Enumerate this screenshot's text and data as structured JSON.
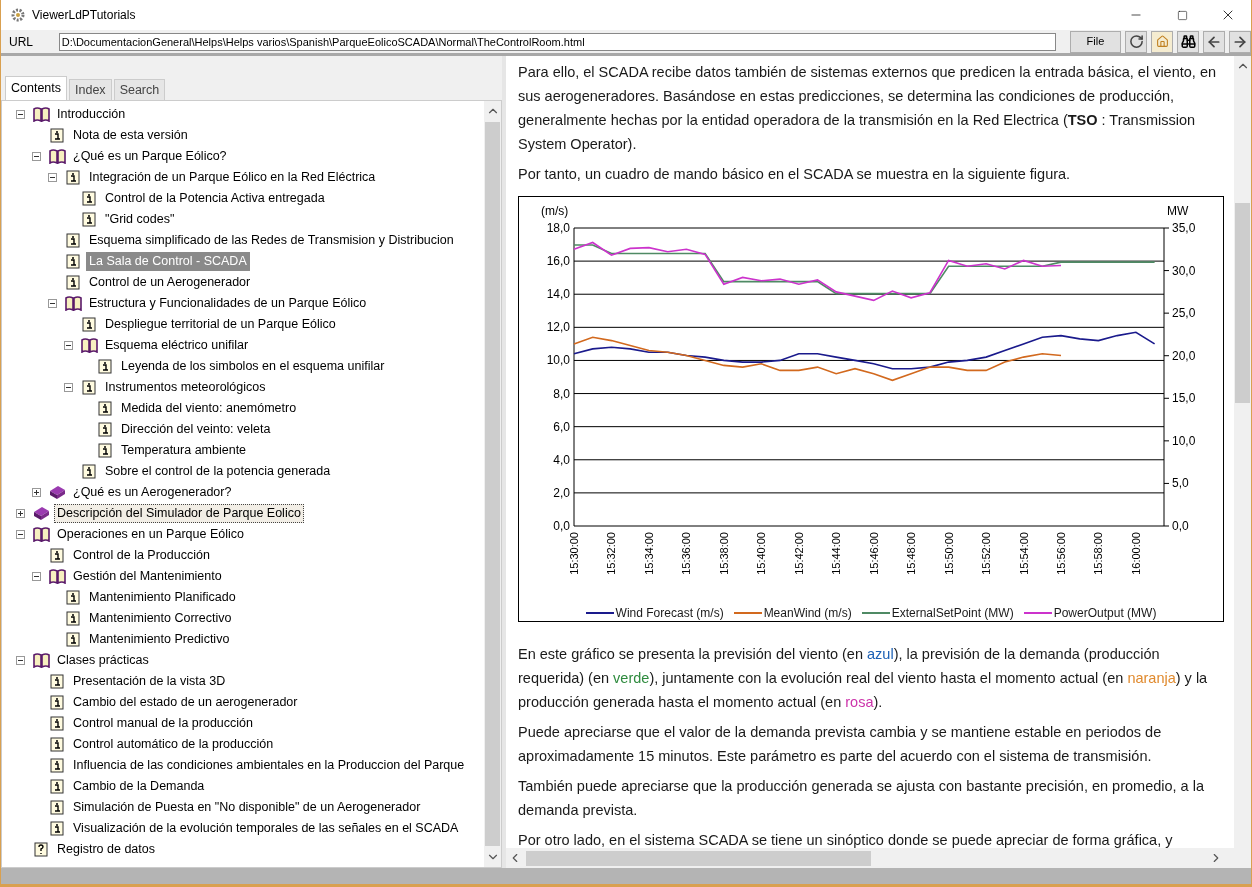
{
  "window": {
    "title": "ViewerLdPTutorials"
  },
  "url_bar": {
    "label": "URL",
    "value": "D:\\DocumentacionGeneral\\Helps\\Helps varios\\Spanish\\ParqueEolicoSCADA\\Normal\\TheControlRoom.html",
    "file_button": "File"
  },
  "tabs": [
    {
      "label": "Contents",
      "selected": true
    },
    {
      "label": "Index",
      "selected": false
    },
    {
      "label": "Search",
      "selected": false
    }
  ],
  "tree": [
    {
      "kind": "book",
      "label": "Introducción",
      "expanded": true,
      "selected": false,
      "focused": false,
      "children": [
        {
          "kind": "page",
          "label": "Nota de esta versión",
          "selected": false,
          "focused": false
        },
        {
          "kind": "book",
          "label": "¿Qué es un Parque Eólico?",
          "expanded": true,
          "selected": false,
          "focused": false,
          "children": [
            {
              "kind": "page",
              "label": "Integración de un Parque Eólico en la Red Eléctrica",
              "expanded": true,
              "selected": false,
              "focused": false,
              "children": [
                {
                  "kind": "page",
                  "label": "Control de la Potencia Activa entregada",
                  "selected": false,
                  "focused": false
                },
                {
                  "kind": "page",
                  "label": "\"Grid codes\"",
                  "selected": false,
                  "focused": false
                }
              ]
            },
            {
              "kind": "page",
              "label": "Esquema simplificado de las Redes de Transmision y Distribucion",
              "selected": false,
              "focused": false
            },
            {
              "kind": "page",
              "label": "La Sala de Control - SCADA",
              "selected": true,
              "focused": false
            },
            {
              "kind": "page",
              "label": "Control de un Aerogenerador",
              "selected": false,
              "focused": false
            },
            {
              "kind": "book",
              "label": "Estructura y Funcionalidades de un Parque Eólico",
              "expanded": true,
              "selected": false,
              "focused": false,
              "children": [
                {
                  "kind": "page",
                  "label": "Despliegue territorial de un Parque Eólico",
                  "selected": false,
                  "focused": false
                },
                {
                  "kind": "book",
                  "label": "Esquema eléctrico unifilar",
                  "expanded": true,
                  "selected": false,
                  "focused": false,
                  "children": [
                    {
                      "kind": "page",
                      "label": "Leyenda de los simbolos en el esquema unifilar",
                      "selected": false,
                      "focused": false
                    }
                  ]
                },
                {
                  "kind": "page",
                  "label": "Instrumentos meteorológicos",
                  "expanded": true,
                  "selected": false,
                  "focused": false,
                  "children": [
                    {
                      "kind": "page",
                      "label": "Medida del viento: anemómetro",
                      "selected": false,
                      "focused": false
                    },
                    {
                      "kind": "page",
                      "label": "Dirección del veinto: veleta",
                      "selected": false,
                      "focused": false
                    },
                    {
                      "kind": "page",
                      "label": "Temperatura ambiente",
                      "selected": false,
                      "focused": false
                    }
                  ]
                },
                {
                  "kind": "page",
                  "label": "Sobre el control de la potencia generada",
                  "selected": false,
                  "focused": false
                }
              ]
            }
          ]
        },
        {
          "kind": "book",
          "label": "¿Qué es un Aerogenerador?",
          "expanded": false,
          "selected": false,
          "focused": false
        }
      ]
    },
    {
      "kind": "book",
      "label": "Descripción del Simulador de Parque Eolico",
      "expanded": false,
      "selected": false,
      "focused": true
    },
    {
      "kind": "book",
      "label": "Operaciones en un Parque Eólico",
      "expanded": true,
      "selected": false,
      "focused": false,
      "children": [
        {
          "kind": "page",
          "label": "Control de la Producción",
          "selected": false,
          "focused": false
        },
        {
          "kind": "book",
          "label": "Gestión del Mantenimiento",
          "expanded": true,
          "selected": false,
          "focused": false,
          "children": [
            {
              "kind": "page",
              "label": "Mantenimiento Planificado",
              "selected": false,
              "focused": false
            },
            {
              "kind": "page",
              "label": "Mantenimiento Correctivo",
              "selected": false,
              "focused": false
            },
            {
              "kind": "page",
              "label": "Mantenimiento Predictivo",
              "selected": false,
              "focused": false
            }
          ]
        }
      ]
    },
    {
      "kind": "book",
      "label": "Clases prácticas",
      "expanded": true,
      "selected": false,
      "focused": false,
      "children": [
        {
          "kind": "page",
          "label": "Presentación de la vista 3D",
          "selected": false,
          "focused": false
        },
        {
          "kind": "page",
          "label": "Cambio del estado de un aerogenerador",
          "selected": false,
          "focused": false
        },
        {
          "kind": "page",
          "label": "Control manual de la producción",
          "selected": false,
          "focused": false
        },
        {
          "kind": "page",
          "label": "Control automático de la producción",
          "selected": false,
          "focused": false
        },
        {
          "kind": "page",
          "label": "Influencia de las condiciones ambientales en la Produccion del Parque",
          "selected": false,
          "focused": false
        },
        {
          "kind": "page",
          "label": "Cambio de la Demanda",
          "selected": false,
          "focused": false
        },
        {
          "kind": "page",
          "label": "Simulación de Puesta en \"No disponible\" de un Aerogenerador",
          "selected": false,
          "focused": false
        },
        {
          "kind": "page",
          "label": "Visualización de la evolución temporales de las señales en el SCADA",
          "selected": false,
          "focused": false
        }
      ]
    },
    {
      "kind": "help",
      "label": "Registro de datos",
      "selected": false,
      "focused": false
    }
  ],
  "content": {
    "intro": [
      "Para ello, el SCADA recibe datos también de sistemas externos que predicen la entrada básica, el viento, en sus aerogeneradores. Basándose en estas predicciones, se determina las condiciones de producción, generalmente hechas por la entidad operadora de la transmisión en la Red Electrica (**TSO** : Transmission System Operator).",
      "Por tanto, un cuadro de mando básico en el SCADA se muestra en la siguiente figura."
    ],
    "chart_data": {
      "type": "line",
      "grid": true,
      "legend": "bottom",
      "ylabel": "(m/s)",
      "y2label": "MW",
      "ylim": [
        0,
        18
      ],
      "yticks": [
        {
          "value": 0,
          "label": "0,0"
        },
        {
          "value": 2,
          "label": "2,0"
        },
        {
          "value": 4,
          "label": "4,0"
        },
        {
          "value": 6,
          "label": "6,0"
        },
        {
          "value": 8,
          "label": "8,0"
        },
        {
          "value": 10,
          "label": "10,0"
        },
        {
          "value": 12,
          "label": "12,0"
        },
        {
          "value": 14,
          "label": "14,0"
        },
        {
          "value": 16,
          "label": "16,0"
        },
        {
          "value": 18,
          "label": "18,0"
        }
      ],
      "y2lim": [
        0,
        35
      ],
      "y2ticks": [
        {
          "value": 0,
          "label": "0,0"
        },
        {
          "value": 5,
          "label": "5,0"
        },
        {
          "value": 10,
          "label": "10,0"
        },
        {
          "value": 15,
          "label": "15,0"
        },
        {
          "value": 20,
          "label": "20,0"
        },
        {
          "value": 25,
          "label": "25,0"
        },
        {
          "value": 30,
          "label": "30,0"
        },
        {
          "value": 35,
          "label": "35,0"
        }
      ],
      "categories": [
        "15:30:00",
        null,
        "15:32:00",
        null,
        "15:34:00",
        null,
        "15:36:00",
        null,
        "15:38:00",
        null,
        "15:40:00",
        null,
        "15:42:00",
        null,
        "15:44:00",
        null,
        "15:46:00",
        null,
        "15:48:00",
        null,
        "15:50:00",
        null,
        "15:52:00",
        null,
        "15:54:00",
        null,
        "15:56:00",
        null,
        "15:58:00",
        null,
        "16:00:00",
        null
      ],
      "series": [
        {
          "name": "Wind Forecast (m/s)",
          "color": "#1a1a8c",
          "values": [
            10.4,
            10.7,
            10.8,
            10.7,
            10.5,
            10.5,
            10.3,
            10.2,
            10.0,
            9.9,
            9.9,
            10.0,
            10.4,
            10.4,
            10.2,
            10.0,
            9.8,
            9.5,
            9.5,
            9.6,
            9.9,
            10.0,
            10.2,
            10.6,
            11.0,
            11.4,
            11.5,
            11.3,
            11.2,
            11.5,
            11.7,
            11.0
          ]
        },
        {
          "name": "MeanWind (m/s)",
          "color": "#d2691e",
          "values": [
            11.0,
            11.4,
            11.2,
            10.9,
            10.6,
            10.5,
            10.3,
            10.0,
            9.7,
            9.6,
            9.8,
            9.4,
            9.4,
            9.6,
            9.2,
            9.5,
            9.2,
            8.8,
            9.2,
            9.6,
            9.6,
            9.4,
            9.4,
            9.9,
            10.2,
            10.4,
            10.3,
            null,
            null,
            null,
            null,
            null
          ]
        },
        {
          "name": "ExternalSetPoint (MW)",
          "color": "#4f8a64",
          "axis": "y2",
          "values": [
            33,
            33,
            32,
            32,
            32,
            32,
            32,
            32,
            28.7,
            28.7,
            28.7,
            28.7,
            28.7,
            28.7,
            27.3,
            27.3,
            27.3,
            27.3,
            27.3,
            27.3,
            30.5,
            30.5,
            30.5,
            30.5,
            30.5,
            30.5,
            31,
            31,
            31,
            31,
            31,
            31
          ]
        },
        {
          "name": "PowerOutput (MW)",
          "color": "#cc33cc",
          "axis": "y2",
          "values": [
            32.5,
            33.3,
            31.8,
            32.6,
            32.7,
            32.2,
            32.5,
            31.9,
            28.4,
            29.2,
            28.8,
            29.0,
            28.4,
            28.9,
            27.5,
            27.0,
            26.5,
            27.6,
            26.8,
            27.4,
            31.2,
            30.5,
            30.8,
            30.2,
            31.2,
            30.5,
            30.6,
            null,
            null,
            null,
            null,
            null
          ]
        }
      ]
    },
    "description": [
      {
        "text": "En este gráfico se presenta la previsión del viento (en "
      },
      {
        "text": "azul",
        "color": "#1a5fb4"
      },
      {
        "text": "), la previsión de la demanda (producción requerida) (en "
      },
      {
        "text": "verde",
        "color": "#2e8b3e"
      },
      {
        "text": "), juntamente con la evolución real del viento hasta el momento actual (en "
      },
      {
        "text": "naranja",
        "color": "#e08a2e"
      },
      {
        "text": ") y la producción generada hasta el momento actual (en "
      },
      {
        "text": "rosa",
        "color": "#cc33aa"
      },
      {
        "text": ")."
      }
    ],
    "paragraphs": [
      "Puede apreciarse que el valor de la demanda prevista cambia y se mantiene estable en periodos de aproximadamente 15 minutos. Este parámetro es parte del acuerdo con el sistema de transmisión.",
      "También puede apreciarse que la producción generada se ajusta con bastante precisión, en promedio, a la demanda prevista.",
      "Por otro lado, en el sistema SCADA se tiene un sinóptico donde se puede apreciar de forma gráfica, y"
    ]
  }
}
